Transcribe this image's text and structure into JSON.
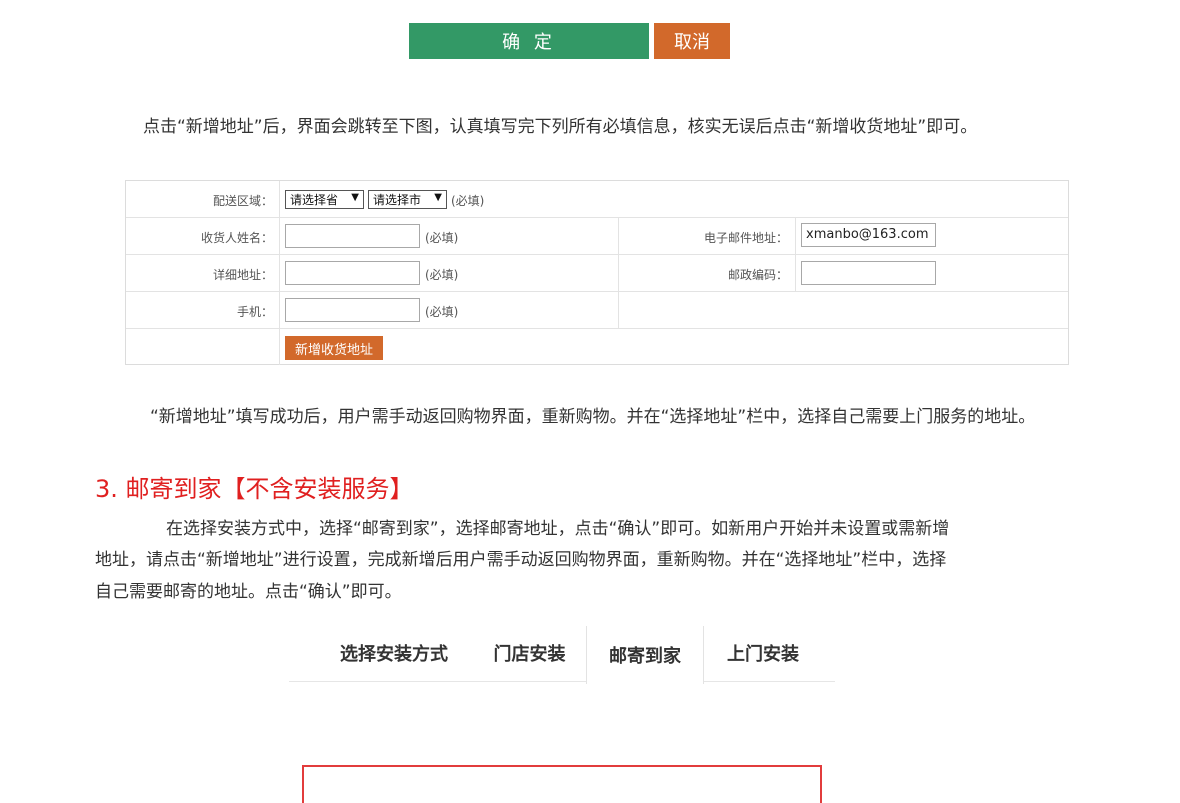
{
  "buttons": {
    "confirm": "确 定",
    "cancel": "取消"
  },
  "para1": "点击“新增地址”后，界面会跳转至下图，认真填写完下列所有必填信息，核实无误后点击“新增收货地址”即可。",
  "form": {
    "region_label": "配送区域：",
    "province_select": "请选择省",
    "city_select": "请选择市",
    "required": "(必填)",
    "name_label": "收货人姓名：",
    "email_label": "电子邮件地址：",
    "email_value": "xmanbo@163.com",
    "address_label": "详细地址：",
    "zip_label": "邮政编码：",
    "phone_label": "手机：",
    "submit": "新增收货地址"
  },
  "para2": "“新增地址”填写成功后，用户需手动返回购物界面，重新购物。并在“选择地址”栏中，选择自己需要上门服务的地址。",
  "section": {
    "title": "3. 邮寄到家【不含安装服务】"
  },
  "para3": [
    "在选择安装方式中，选择“邮寄到家”，选择邮寄地址，点击“确认”即可。如新用户开始并未设置或需新增",
    "地址，请点击“新增地址”进行设置，完成新增后用户需手动返回购物界面，重新购物。并在“选择地址”栏中，选择",
    "自己需要邮寄的地址。点击“确认”即可。"
  ],
  "tabs": [
    {
      "label": "选择安装方式"
    },
    {
      "label": "门店安装"
    },
    {
      "label": "邮寄到家"
    },
    {
      "label": "上门安装"
    }
  ],
  "colors": {
    "confirm": "#339966",
    "cancel": "#d2692b",
    "section_title": "#e02020"
  }
}
